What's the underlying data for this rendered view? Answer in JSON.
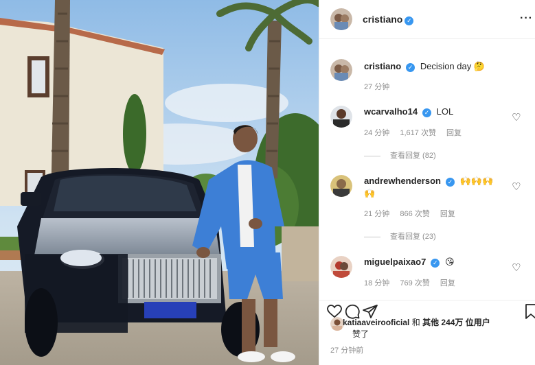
{
  "post": {
    "username": "cristiano",
    "verified_icon": "verified-badge-icon",
    "more_icon": "more-options-icon",
    "more_label": "···"
  },
  "caption": {
    "username": "cristiano",
    "text": "Decision day",
    "emoji": "🤔",
    "time": "27 分钟"
  },
  "comments": [
    {
      "username": "wcarvalho14",
      "verified": true,
      "text": "LOL",
      "time": "24 分钟",
      "likes": "1,617 次赞",
      "reply": "回复",
      "view_replies": "查看回复 (82)"
    },
    {
      "username": "andrewhenderson",
      "verified": true,
      "text": "",
      "emojis": "🙌🙌🙌",
      "emojis_line2": "🙌",
      "time": "21 分钟",
      "likes": "866 次赞",
      "reply": "回复",
      "view_replies": "查看回复 (23)"
    },
    {
      "username": "miguelpaixao7",
      "verified": true,
      "text": "",
      "emojis": "😘",
      "time": "18 分钟",
      "likes": "769 次赞",
      "reply": "回复"
    }
  ],
  "likes": {
    "user": "katiaaveirooficial",
    "and": "和",
    "others": "其他 244万 位用户",
    "liked": "赞了"
  },
  "timestamp": "27 分钟前",
  "colors": {
    "verified_blue": "#3897f0",
    "muted_text": "#8e8e8e",
    "jacket_blue": "#3d7fd6"
  }
}
